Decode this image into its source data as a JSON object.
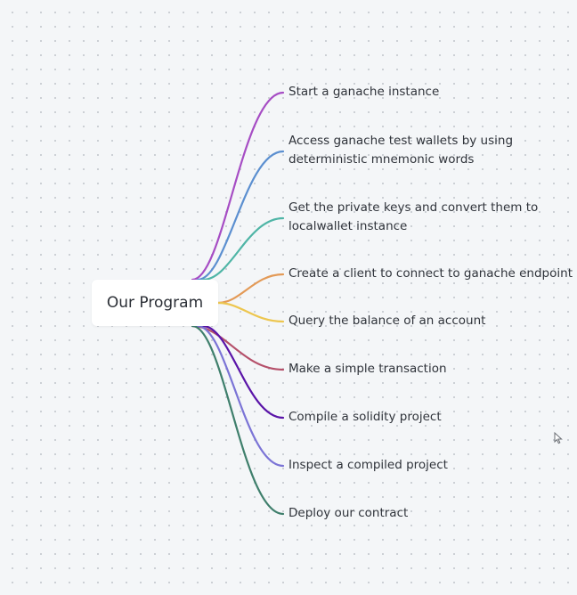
{
  "mindmap": {
    "root": {
      "label": "Our Program"
    },
    "branches": [
      {
        "label": "Start a ganache instance",
        "color": "#a64dc4"
      },
      {
        "label": "Access ganache test wallets by using\ndeterministic mnemonic words",
        "color": "#5b8fd0"
      },
      {
        "label": "Get the private keys and convert them to\nlocalwallet instance",
        "color": "#4fb5a6"
      },
      {
        "label": "Create a client to connect to ganache endpoint",
        "color": "#e39a57"
      },
      {
        "label": "Query the balance of an account",
        "color": "#edc64f"
      },
      {
        "label": "Make a simple transaction",
        "color": "#b5506a"
      },
      {
        "label": "Compile a solidity project",
        "color": "#5a14a8"
      },
      {
        "label": "Inspect a compiled project",
        "color": "#7b74d6"
      },
      {
        "label": "Deploy our contract",
        "color": "#3f7f6c"
      }
    ]
  },
  "colors": {
    "background": "#f4f6f8",
    "node_background": "#ffffff",
    "text": "#2f333a"
  },
  "icons": {
    "cursor": "mouse-pointer-icon"
  }
}
